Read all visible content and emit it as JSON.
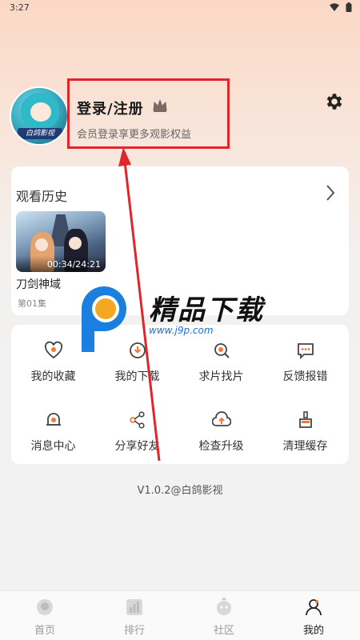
{
  "status": {
    "time": "3:27"
  },
  "profile": {
    "login_title": "登录/注册",
    "login_subtitle": "会员登录享更多观影权益",
    "avatar_caption": "白鸽影视"
  },
  "history": {
    "title": "观看历史",
    "items": [
      {
        "name": "刀剑神域",
        "episode": "第01集",
        "progress": "00:34/24:21"
      }
    ]
  },
  "menu": {
    "items": [
      {
        "label": "我的收藏",
        "icon": "heart-icon"
      },
      {
        "label": "我的下载",
        "icon": "download-icon"
      },
      {
        "label": "求片找片",
        "icon": "search-icon"
      },
      {
        "label": "反馈报错",
        "icon": "feedback-icon"
      },
      {
        "label": "消息中心",
        "icon": "bell-icon"
      },
      {
        "label": "分享好友",
        "icon": "share-icon"
      },
      {
        "label": "检查升级",
        "icon": "upgrade-icon"
      },
      {
        "label": "清理缓存",
        "icon": "broom-icon"
      }
    ]
  },
  "version": "V1.0.2@白鸽影视",
  "watermark": {
    "title": "精品下载",
    "url": "www.j9p.com"
  },
  "tabs": [
    {
      "label": "首页",
      "icon": "home-icon"
    },
    {
      "label": "排行",
      "icon": "ranking-icon"
    },
    {
      "label": "社区",
      "icon": "community-icon"
    },
    {
      "label": "我的",
      "icon": "profile-icon",
      "active": true
    }
  ],
  "colors": {
    "accent": "#f07a3a",
    "annotation": "#e0262b",
    "icon": "#f07a3a"
  }
}
